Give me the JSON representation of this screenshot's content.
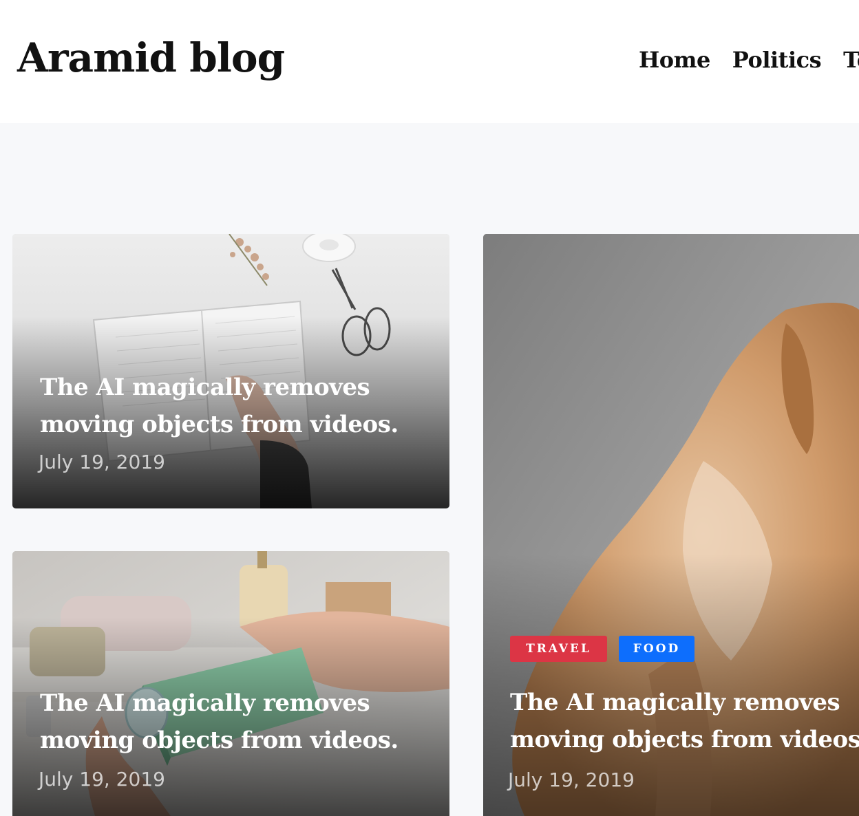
{
  "header": {
    "logo": "Aramid blog",
    "nav": [
      "Home",
      "Politics",
      "Te"
    ]
  },
  "posts": [
    {
      "title": "The AI magically removes moving objects from videos.",
      "date": "July 19, 2019"
    },
    {
      "title": "The AI magically removes moving objects from videos.",
      "date": "July 19, 2019"
    },
    {
      "title": "The AI magically removes moving objects from videos.",
      "date": "July 19, 2019",
      "tags": [
        "TRAVEL",
        "FOOD"
      ]
    }
  ],
  "colors": {
    "tag_travel": "#dc3545",
    "tag_food": "#0d6efd",
    "page_background": "#f7f8fa"
  }
}
